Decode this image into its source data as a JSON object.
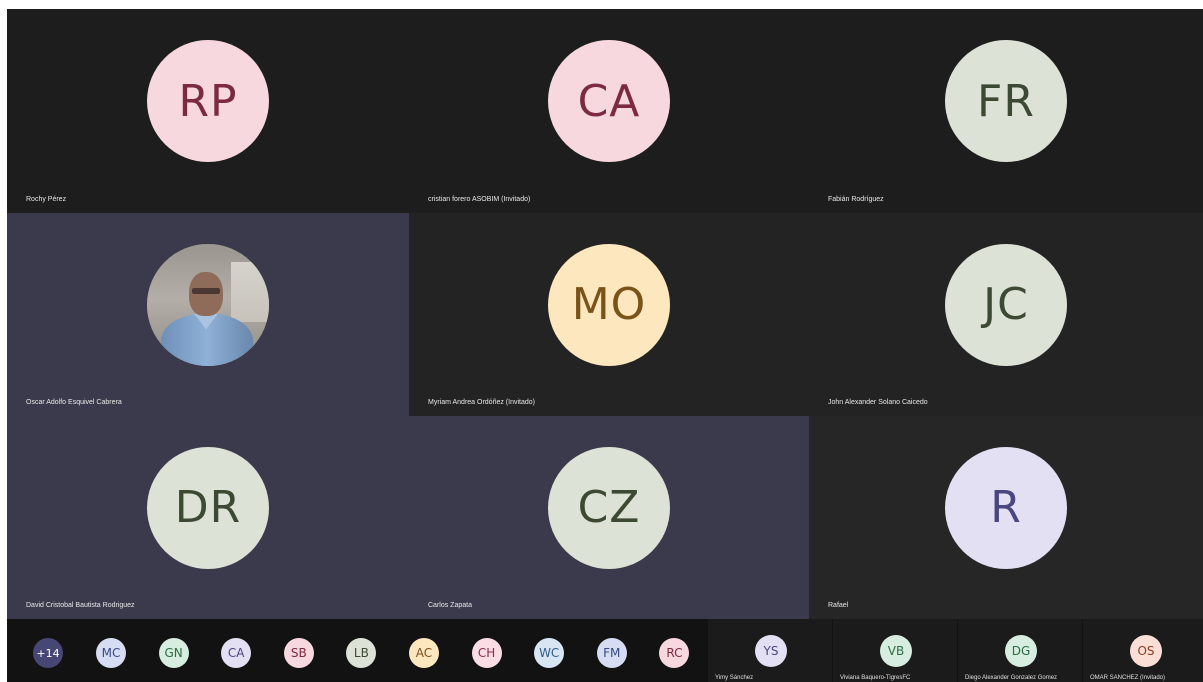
{
  "colors": {
    "tile_dark": "#1f1f1f",
    "tile_active": "#3b3a4c",
    "strip_bg": "#121212",
    "overflow_chip": "#464775"
  },
  "participants": [
    {
      "initials": "RP",
      "name": "Rochy Pérez",
      "avatar_bg": "#f8d8df",
      "avatar_fg": "#7b2a41",
      "tile_bg": "#1d1d1d"
    },
    {
      "initials": "CA",
      "name": "cristian forero ASOBIM (Invitado)",
      "avatar_bg": "#f8d8df",
      "avatar_fg": "#7b2a41",
      "tile_bg": "#1d1d1d"
    },
    {
      "initials": "FR",
      "name": "Fabián Rodríguez",
      "avatar_bg": "#dde2d6",
      "avatar_fg": "#3c4a33",
      "tile_bg": "#1d1d1d"
    },
    {
      "initials": "",
      "name": "Oscar Adolfo Esquivel Cabrera",
      "video": true,
      "tile_bg": "#3b3a4c"
    },
    {
      "initials": "MO",
      "name": "Myriam Andrea Ordóñez (Invitado)",
      "avatar_bg": "#fde7bf",
      "avatar_fg": "#7a5318",
      "tile_bg": "#232323"
    },
    {
      "initials": "JC",
      "name": "John Alexander Solano Caicedo",
      "avatar_bg": "#dde2d6",
      "avatar_fg": "#3c4a33",
      "tile_bg": "#232323"
    },
    {
      "initials": "DR",
      "name": "David Cristobal Bautista Rodriguez",
      "avatar_bg": "#dde2d6",
      "avatar_fg": "#3c4a33",
      "tile_bg": "#3b3a4c"
    },
    {
      "initials": "CZ",
      "name": "Carlos Zapata",
      "avatar_bg": "#dde2d6",
      "avatar_fg": "#3c4a33",
      "tile_bg": "#3b3a4c"
    },
    {
      "initials": "R",
      "name": "Rafael",
      "avatar_bg": "#e4e0f4",
      "avatar_fg": "#4a4680",
      "tile_bg": "#262626"
    }
  ],
  "overflow": {
    "label": "+14"
  },
  "strip_chips": [
    {
      "initials": "MC",
      "bg": "#d6dcf2",
      "fg": "#3a4a86"
    },
    {
      "initials": "GN",
      "bg": "#d6eddf",
      "fg": "#2e6b45"
    },
    {
      "initials": "CA",
      "bg": "#e4e0f4",
      "fg": "#4a4680"
    },
    {
      "initials": "SB",
      "bg": "#f8d8df",
      "fg": "#7b2a41"
    },
    {
      "initials": "LB",
      "bg": "#dde2d6",
      "fg": "#3c4a33"
    },
    {
      "initials": "AC",
      "bg": "#fde7bf",
      "fg": "#7a5318"
    },
    {
      "initials": "CH",
      "bg": "#fbdde6",
      "fg": "#8c2e52"
    },
    {
      "initials": "WC",
      "bg": "#d8e6f4",
      "fg": "#2d5c8a"
    },
    {
      "initials": "FM",
      "bg": "#d6dcf2",
      "fg": "#3a4a86"
    },
    {
      "initials": "RC",
      "bg": "#f8d8df",
      "fg": "#7b2a41"
    }
  ],
  "strip_tiles": [
    {
      "initials": "YS",
      "name": "Yimy Sánchez",
      "bg": "#e4e0f4",
      "fg": "#4a4680"
    },
    {
      "initials": "VB",
      "name": "Viviana Baquero-TigresFC",
      "bg": "#d6eddf",
      "fg": "#2e6b45"
    },
    {
      "initials": "DG",
      "name": "Diego Alexander Gonzalez Gomez",
      "bg": "#d6eddf",
      "fg": "#2e6b45"
    },
    {
      "initials": "OS",
      "name": "OMAR SANCHEZ (Invitado)",
      "bg": "#fbdfd6",
      "fg": "#8a3b22"
    }
  ]
}
